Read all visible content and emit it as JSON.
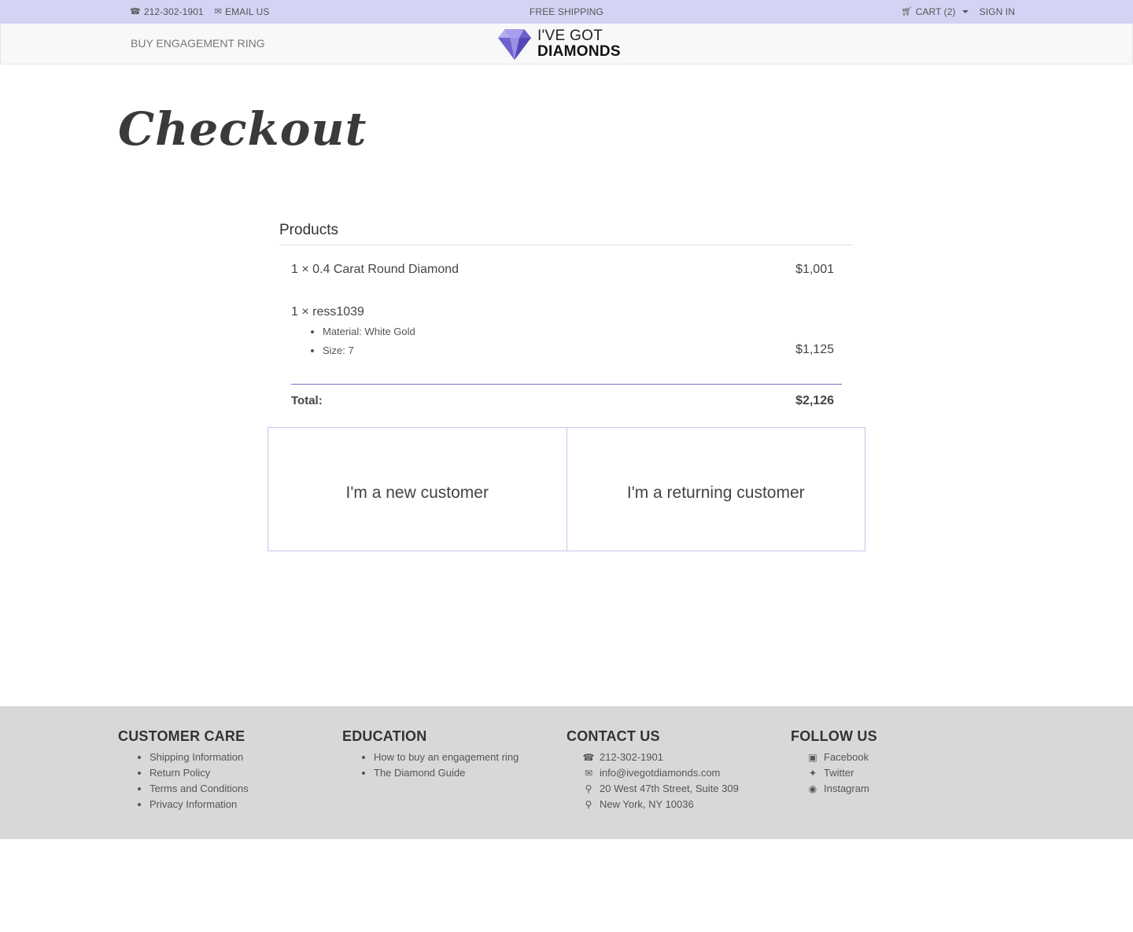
{
  "topbar": {
    "phone": "212-302-1901",
    "email_label": "EMAIL US",
    "promo": "FREE SHIPPING",
    "cart_label": "CART (2)",
    "signin_label": "SIGN IN"
  },
  "nav": {
    "buy_ring": "BUY ENGAGEMENT RING",
    "logo_line1": "I'VE GOT",
    "logo_line2": "DIAMONDS"
  },
  "page": {
    "title": "Checkout"
  },
  "products": {
    "heading": "Products",
    "items": [
      {
        "name": "1 × 0.4 Carat Round Diamond",
        "price": "$1,001"
      },
      {
        "name": "1 × ress1039",
        "options": [
          "Material: White Gold",
          "Size: 7"
        ],
        "price": "$1,125"
      }
    ],
    "total_label": "Total:",
    "total_value": "$2,126"
  },
  "customer": {
    "new_label": "I'm a new customer",
    "returning_label": "I'm a returning customer"
  },
  "footer": {
    "care": {
      "heading": "CUSTOMER CARE",
      "links": [
        "Shipping Information",
        "Return Policy",
        "Terms and Conditions",
        "Privacy Information"
      ]
    },
    "education": {
      "heading": "EDUCATION",
      "links": [
        "How to buy an engagement ring",
        "The Diamond Guide"
      ]
    },
    "contact": {
      "heading": "CONTACT US",
      "phone": "212-302-1901",
      "email": "info@ivegotdiamonds.com",
      "address1": "20 West 47th Street, Suite 309",
      "address2": "New York, NY 10036"
    },
    "follow": {
      "heading": "FOLLOW US",
      "links": [
        "Facebook",
        "Twitter",
        "Instagram"
      ]
    }
  },
  "colors": {
    "topbar_bg": "#d5d3f3",
    "accent": "#7c72c8",
    "footer_bg": "#d8d8d8"
  }
}
